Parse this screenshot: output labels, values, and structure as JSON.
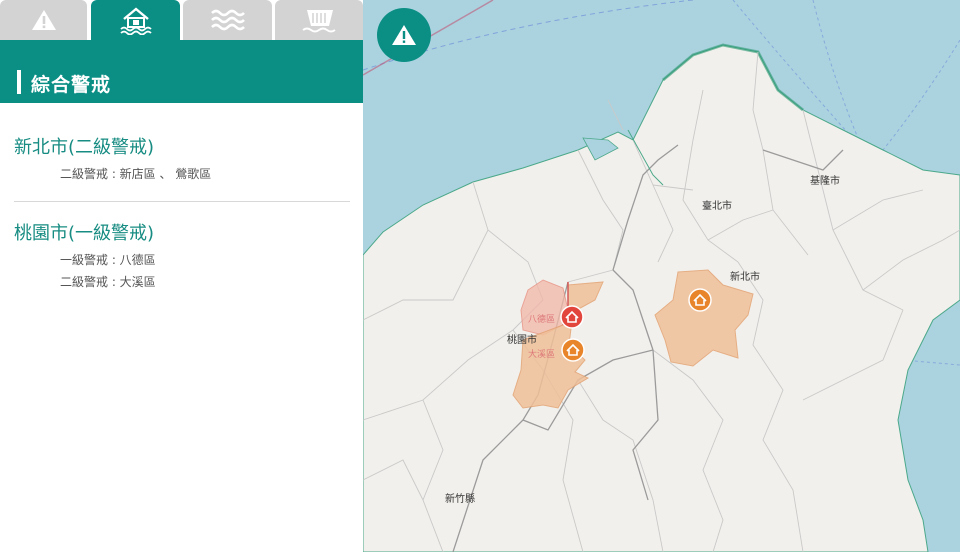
{
  "tabs": [
    {
      "icon": "warning-triangle-icon",
      "active": false
    },
    {
      "icon": "flooded-house-icon",
      "active": true
    },
    {
      "icon": "waves-icon",
      "active": false
    },
    {
      "icon": "dam-icon",
      "active": false
    }
  ],
  "panel": {
    "title": "綜合警戒",
    "regions": [
      {
        "city": "新北市(二級警戒)",
        "lines": [
          "二級警戒 : 新店區 、 鶯歌區"
        ]
      },
      {
        "city": "桃園市(一級警戒)",
        "lines": [
          "一級警戒 : 八德區",
          "二級警戒 : 大溪區"
        ]
      }
    ]
  },
  "map": {
    "labels": {
      "keelung": "基隆市",
      "taipei": "臺北市",
      "new_taipei": "新北市",
      "taoyuan": "桃園市",
      "hsinchu_county": "新竹縣",
      "bade": "八德區",
      "daxi": "大溪區"
    },
    "markers": [
      {
        "name": "八德區",
        "level": "一級警戒",
        "color": "#e2453c"
      },
      {
        "name": "大溪區",
        "level": "二級警戒",
        "color": "#e8852a"
      },
      {
        "name": "新北市",
        "level": "二級警戒",
        "color": "#e8852a"
      }
    ],
    "colors": {
      "level1": "#e2453c",
      "level2": "#e8852a",
      "water": "#aad3df",
      "accent": "#0b8f85"
    }
  }
}
